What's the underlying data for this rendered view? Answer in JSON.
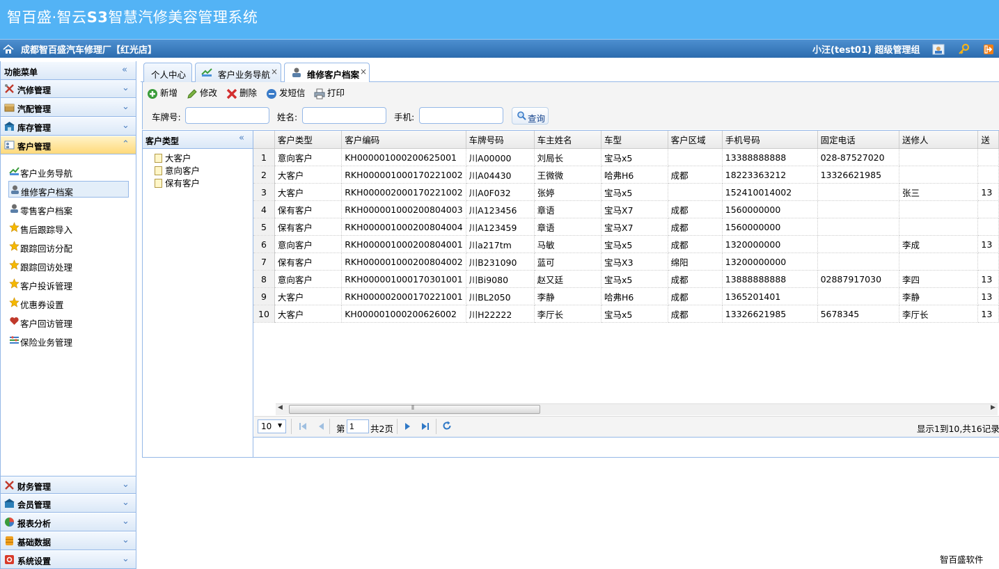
{
  "app": {
    "title_prefix": "智百盛·智云",
    "title_bold": "S3",
    "title_suffix": "智慧汽修美容管理系统"
  },
  "header": {
    "store_name": "成都智百盛汽车修理厂【红光店】",
    "user_info": "小汪(test01)  超级管理组"
  },
  "sidebar": {
    "title": "功能菜单",
    "top_sections": [
      {
        "label": "汽修管理",
        "icon": "repair-tools-icon"
      },
      {
        "label": "汽配管理",
        "icon": "parts-box-icon"
      },
      {
        "label": "库存管理",
        "icon": "warehouse-icon"
      },
      {
        "label": "客户管理",
        "icon": "customer-card-icon"
      }
    ],
    "sub_items": [
      {
        "label": "客户业务导航",
        "icon": "navigation-icon"
      },
      {
        "label": "维修客户档案",
        "icon": "repair-customer-icon"
      },
      {
        "label": "零售客户档案",
        "icon": "retail-customer-icon"
      },
      {
        "label": "售后跟踪导入",
        "icon": "star-icon"
      },
      {
        "label": "跟踪回访分配",
        "icon": "star-icon"
      },
      {
        "label": "跟踪回访处理",
        "icon": "star-icon"
      },
      {
        "label": "客户投诉管理",
        "icon": "star-icon"
      },
      {
        "label": "优惠券设置",
        "icon": "star-icon"
      },
      {
        "label": "客户回访管理",
        "icon": "heart-icon"
      },
      {
        "label": "保险业务管理",
        "icon": "insurance-icon"
      }
    ],
    "bottom_sections": [
      {
        "label": "财务管理",
        "icon": "finance-icon"
      },
      {
        "label": "会员管理",
        "icon": "member-icon"
      },
      {
        "label": "报表分析",
        "icon": "pie-chart-icon"
      },
      {
        "label": "基础数据",
        "icon": "database-icon"
      },
      {
        "label": "系统设置",
        "icon": "settings-icon"
      }
    ]
  },
  "tabs": [
    {
      "label": "个人中心"
    },
    {
      "label": "客户业务导航"
    },
    {
      "label": "维修客户档案"
    }
  ],
  "toolbar": {
    "add": "新增",
    "edit": "修改",
    "delete": "删除",
    "sms": "发短信",
    "print": "打印"
  },
  "search": {
    "plate_label": "车牌号:",
    "name_label": "姓名:",
    "phone_label": "手机:",
    "plate_value": "",
    "name_value": "",
    "phone_value": "",
    "button": "查询"
  },
  "category": {
    "title": "客户类型",
    "items": [
      "大客户",
      "意向客户",
      "保有客户"
    ]
  },
  "grid": {
    "columns": [
      "客户类型",
      "客户编码",
      "车牌号码",
      "车主姓名",
      "车型",
      "客户区域",
      "手机号码",
      "固定电话",
      "送修人",
      "送"
    ],
    "rows": [
      [
        "1",
        "意向客户",
        "KH000001000200625001",
        "川A00000",
        "刘局长",
        "宝马x5",
        "",
        "13388888888",
        "028-87527020",
        "",
        ""
      ],
      [
        "2",
        "大客户",
        "RKH000001000170221002",
        "川A04430",
        "王微微",
        "哈弗H6",
        "成都",
        "18223363212",
        "13326621985",
        "",
        ""
      ],
      [
        "3",
        "大客户",
        "RKH000002000170221002",
        "川A0F032",
        "张婷",
        "宝马x5",
        "",
        "152410014002",
        "",
        "张三",
        "13"
      ],
      [
        "4",
        "保有客户",
        "RKH000001000200804003",
        "川A123456",
        "章语",
        "宝马X7",
        "成都",
        "1560000000",
        "",
        "",
        ""
      ],
      [
        "5",
        "保有客户",
        "RKH000001000200804004",
        "川A123459",
        "章语",
        "宝马X7",
        "成都",
        "1560000000",
        "",
        "",
        ""
      ],
      [
        "6",
        "意向客户",
        "RKH000001000200804001",
        "川a217tm",
        "马敏",
        "宝马x5",
        "成都",
        "1320000000",
        "",
        "李成",
        "13"
      ],
      [
        "7",
        "保有客户",
        "RKH000001000200804002",
        "川B231090",
        "蓝可",
        "宝马X3",
        "绵阳",
        "13200000000",
        "",
        "",
        ""
      ],
      [
        "8",
        "意向客户",
        "RKH000001000170301001",
        "川Bi9080",
        "赵又廷",
        "宝马x5",
        "成都",
        "13888888888",
        "02887917030",
        "李四",
        "13"
      ],
      [
        "9",
        "大客户",
        "RKH000002000170221001",
        "川BL2050",
        "李静",
        "哈弗H6",
        "成都",
        "1365201401",
        "",
        "李静",
        "13"
      ],
      [
        "10",
        "大客户",
        "KH000001000200626002",
        "川H22222",
        "李厅长",
        "宝马x5",
        "成都",
        "13326621985",
        "5678345",
        "李厅长",
        "13"
      ]
    ]
  },
  "pager": {
    "page_size": "10",
    "page_prefix": "第",
    "page_value": "1",
    "page_total": "共2页",
    "summary": "显示1到10,共16记录"
  },
  "footer": {
    "text": "智百盛软件"
  },
  "colors": {
    "banner": "#53b3f5",
    "header_bar": "#2c6cae",
    "border": "#95b8e7",
    "active_section": "#ffd97a"
  }
}
